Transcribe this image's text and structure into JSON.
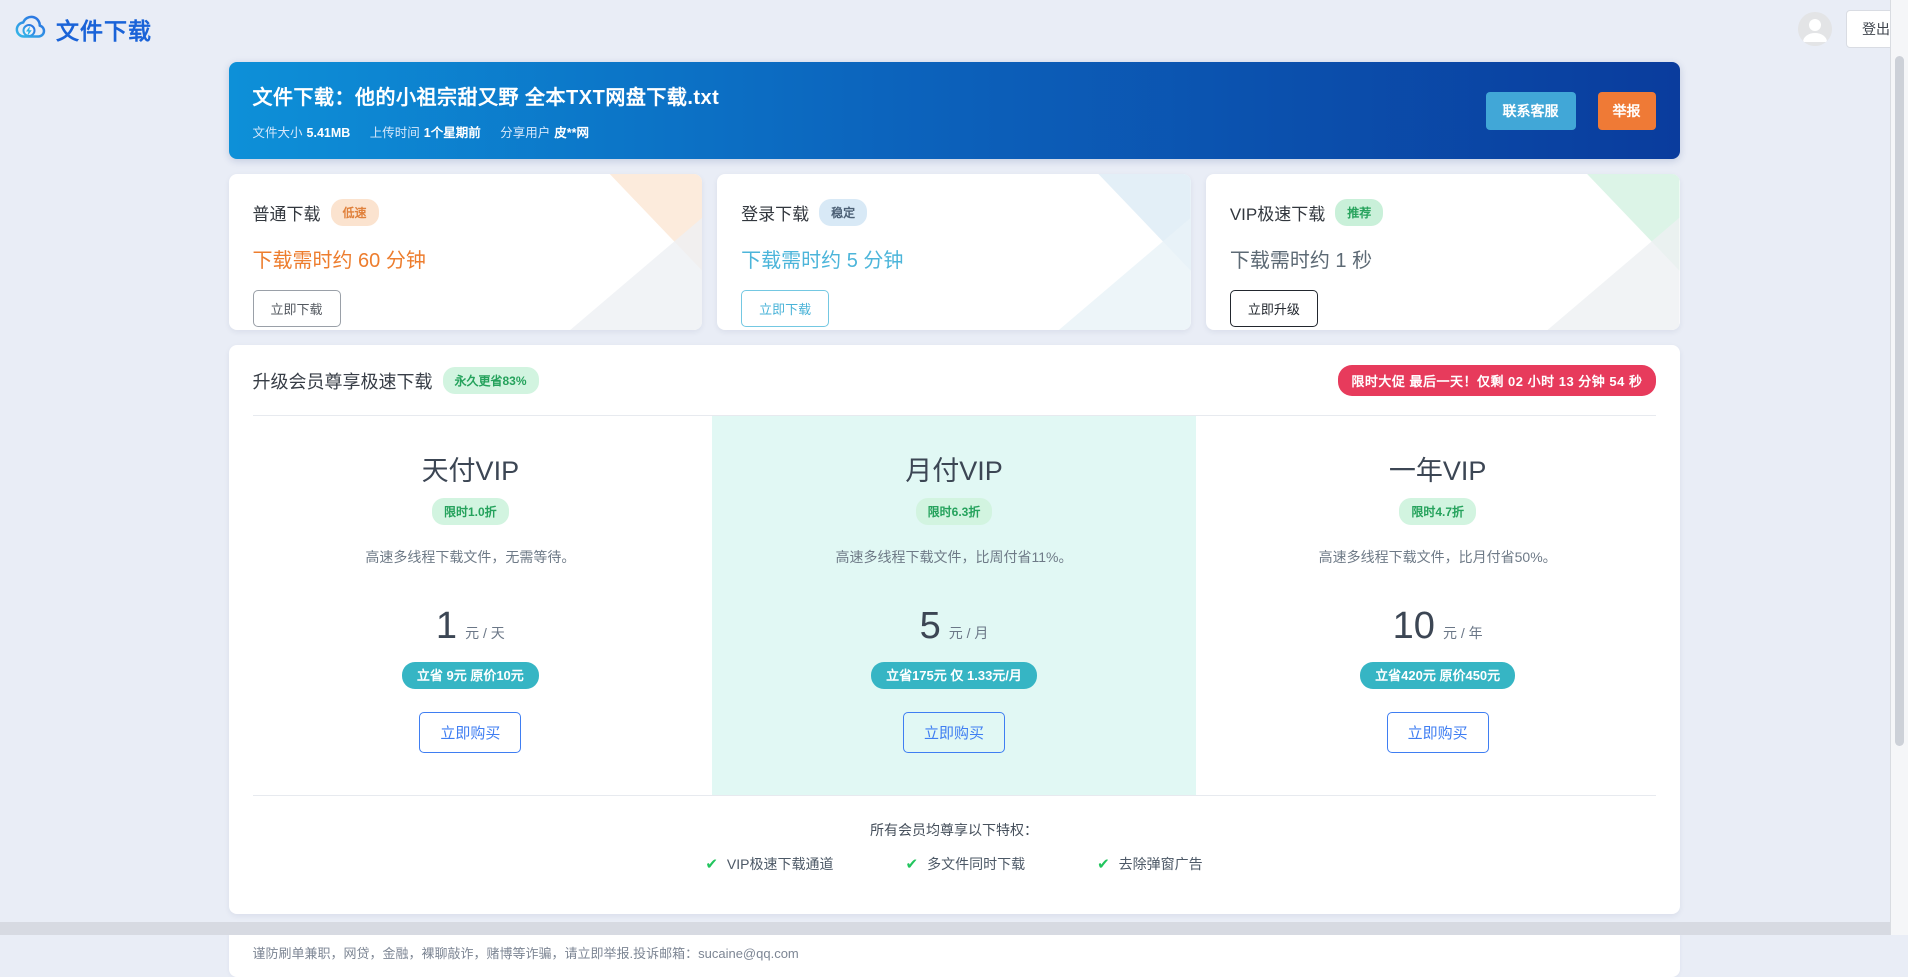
{
  "header": {
    "logo_text": "文件下载",
    "logout_label": "登出"
  },
  "banner": {
    "title": "文件下载：他的小祖宗甜又野 全本TXT网盘下载.txt",
    "meta": [
      {
        "label": "文件大小",
        "value": "5.41MB"
      },
      {
        "label": "上传时间",
        "value": "1个星期前"
      },
      {
        "label": "分享用户",
        "value": "皮**网"
      }
    ],
    "contact_label": "联系客服",
    "report_label": "举报"
  },
  "download_cards": [
    {
      "title": "普通下载",
      "badge": "低速",
      "time": "下载需时约 60 分钟",
      "button": "立即下载"
    },
    {
      "title": "登录下载",
      "badge": "稳定",
      "time": "下载需时约 5 分钟",
      "button": "立即下载"
    },
    {
      "title": "VIP极速下载",
      "badge": "推荐",
      "time": "下载需时约 1 秒",
      "button": "立即升级"
    }
  ],
  "vip": {
    "title": "升级会员尊享极速下载",
    "save_badge": "永久更省83%",
    "countdown": "限时大促 最后一天！仅剩 02 小时 13 分钟 54 秒",
    "plans": [
      {
        "name": "天付VIP",
        "discount": "限时1.0折",
        "desc": "高速多线程下载文件，无需等待。",
        "price": "1",
        "unit": "元 / 天",
        "save": "立省 9元 原价10元",
        "button": "立即购买"
      },
      {
        "name": "月付VIP",
        "discount": "限时6.3折",
        "desc": "高速多线程下载文件，比周付省11%。",
        "price": "5",
        "unit": "元 / 月",
        "save": "立省175元 仅 1.33元/月",
        "button": "立即购买"
      },
      {
        "name": "一年VIP",
        "discount": "限时4.7折",
        "desc": "高速多线程下载文件，比月付省50%。",
        "price": "10",
        "unit": "元 / 年",
        "save": "立省420元 原价450元",
        "button": "立即购买"
      }
    ],
    "perks_title": "所有会员均尊享以下特权：",
    "perks": [
      {
        "label": "VIP极速下载通道"
      },
      {
        "label": "多文件同时下载"
      },
      {
        "label": "去除弹窗广告"
      }
    ]
  },
  "footer": {
    "text": "谨防刷单兼职，网贷，金融，裸聊敲诈，赌博等诈骗，请立即举报.投诉邮箱：sucaine@qq.com"
  },
  "colors": {
    "page_bg": "#e9edf6",
    "banner_gradient_start": "#0d90d8",
    "banner_gradient_end": "#0a3c9d",
    "contact_button": "#41a7d7",
    "report_button": "#ef7a36",
    "slow_text": "#ed7d2e",
    "login_text": "#4cb5da",
    "green_badge_text": "#27a35d",
    "countdown_pill": "#e73b5c",
    "teal_pill": "#36b5c4",
    "buy_blue": "#3f7ef2",
    "highlight_column": "#e1f8f4",
    "check_green": "#22c55e"
  }
}
